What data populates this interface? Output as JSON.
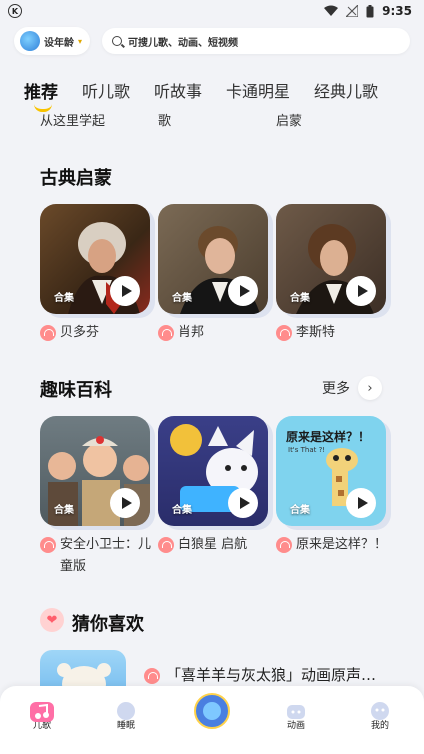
{
  "status_bar": {
    "time": "9:35"
  },
  "header": {
    "age_label": "设年龄",
    "search_placeholder": "可搜儿歌、动画、短视频"
  },
  "tabs": [
    {
      "label": "推荐",
      "active": true
    },
    {
      "label": "听儿歌",
      "active": false
    },
    {
      "label": "听故事",
      "active": false
    },
    {
      "label": "卡通明星",
      "active": false
    },
    {
      "label": "经典儿歌",
      "active": false
    }
  ],
  "prev_row_labels": [
    "从这里学起",
    "歌",
    "启蒙"
  ],
  "classic": {
    "title": "古典启蒙",
    "cards": [
      {
        "badge": "合集",
        "label": "贝多芬"
      },
      {
        "badge": "合集",
        "label": "肖邦"
      },
      {
        "badge": "合集",
        "label": "李斯特"
      }
    ]
  },
  "fun": {
    "title": "趣味百科",
    "more_label": "更多",
    "cards": [
      {
        "badge": "合集",
        "label": "安全小卫士：儿童版"
      },
      {
        "badge": "合集",
        "label": "白狼星 启航"
      },
      {
        "badge": "合集",
        "label": "原来是这样？！",
        "art_text": "原来是这样？！",
        "art_sub": "It's That ?!"
      }
    ]
  },
  "guess": {
    "title": "猜你喜欢",
    "item_title": "「喜羊羊与灰太狼」动画原声…"
  },
  "bottom_nav": [
    {
      "label": "儿歌",
      "active": true
    },
    {
      "label": "睡眠"
    },
    {
      "label": ""
    },
    {
      "label": "动画"
    },
    {
      "label": "我的"
    }
  ],
  "colors": {
    "accent": "#f8c300",
    "background": "#f2f3f7",
    "headphone": "#ff8c8c"
  }
}
